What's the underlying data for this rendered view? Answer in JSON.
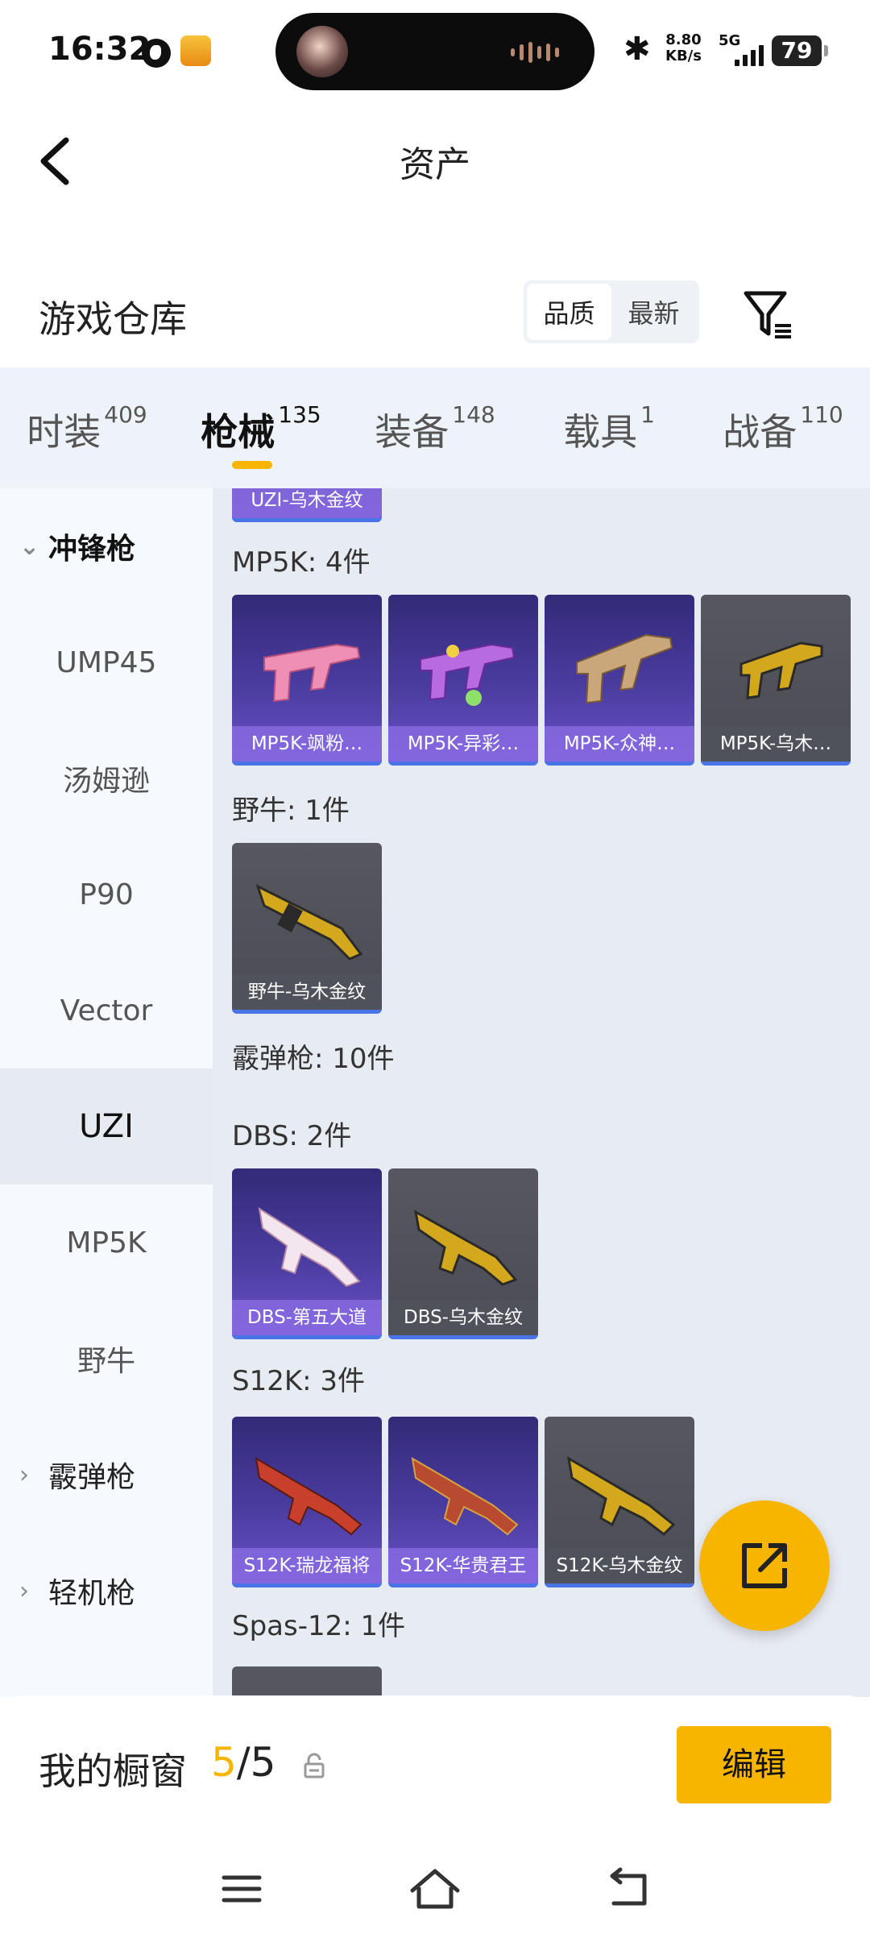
{
  "status_bar": {
    "time": "16:32",
    "net_speed_value": "8.80",
    "net_speed_unit": "KB/s",
    "network": "5G",
    "battery": "79"
  },
  "header": {
    "title": "资产",
    "back_icon": "chevron-left-icon"
  },
  "section": {
    "title": "游戏仓库",
    "sort_options": [
      "品质",
      "最新"
    ],
    "sort_selected": "品质",
    "filter_icon": "filter-icon"
  },
  "tabs": [
    {
      "label": "时装",
      "count": "409"
    },
    {
      "label": "枪械",
      "count": "135"
    },
    {
      "label": "装备",
      "count": "148"
    },
    {
      "label": "载具",
      "count": "1"
    },
    {
      "label": "战备",
      "count": "110"
    }
  ],
  "tab_active": "枪械",
  "sidebar": {
    "items": [
      {
        "label": "冲锋枪",
        "kind": "category",
        "expanded": true
      },
      {
        "label": "UMP45",
        "kind": "sub"
      },
      {
        "label": "汤姆逊",
        "kind": "sub"
      },
      {
        "label": "P90",
        "kind": "sub"
      },
      {
        "label": "Vector",
        "kind": "sub"
      },
      {
        "label": "UZI",
        "kind": "sub",
        "active": true
      },
      {
        "label": "MP5K",
        "kind": "sub"
      },
      {
        "label": "野牛",
        "kind": "sub"
      },
      {
        "label": "霰弹枪",
        "kind": "category"
      },
      {
        "label": "轻机枪",
        "kind": "category"
      }
    ]
  },
  "content": {
    "partial_top_caption": "UZI-乌木金纹",
    "groups": [
      {
        "title": "MP5K: 4件",
        "items": [
          {
            "name": "MP5K-飒粉…",
            "tier": "purple"
          },
          {
            "name": "MP5K-异彩…",
            "tier": "purple"
          },
          {
            "name": "MP5K-众神…",
            "tier": "purple"
          },
          {
            "name": "MP5K-乌木…",
            "tier": "gray"
          }
        ]
      },
      {
        "title": "野牛: 1件",
        "items": [
          {
            "name": "野牛-乌木金纹",
            "tier": "gray"
          }
        ]
      },
      {
        "title": "霰弹枪: 10件",
        "items": []
      },
      {
        "title": "DBS: 2件",
        "items": [
          {
            "name": "DBS-第五大道",
            "tier": "purple"
          },
          {
            "name": "DBS-乌木金纹",
            "tier": "gray"
          }
        ]
      },
      {
        "title": "S12K: 3件",
        "items": [
          {
            "name": "S12K-瑞龙福将",
            "tier": "purple"
          },
          {
            "name": "S12K-华贵君王",
            "tier": "purple"
          },
          {
            "name": "S12K-乌木金纹",
            "tier": "gray"
          }
        ]
      },
      {
        "title": "Spas-12: 1件",
        "items": []
      }
    ]
  },
  "fab": {
    "icon": "share-external-icon"
  },
  "showcase": {
    "label": "我的橱窗",
    "current": "5",
    "separator": "/",
    "total": "5",
    "lock_icon": "lock-icon",
    "edit_label": "编辑"
  },
  "nav": {
    "menu_icon": "menu-icon",
    "home_icon": "home-icon",
    "back_icon": "back-icon"
  },
  "colors": {
    "accent": "#f7b500",
    "purple_card": "#4a3ca0",
    "gray_card": "#4b4c55",
    "card_bottom_bar": "#4a73e8"
  }
}
